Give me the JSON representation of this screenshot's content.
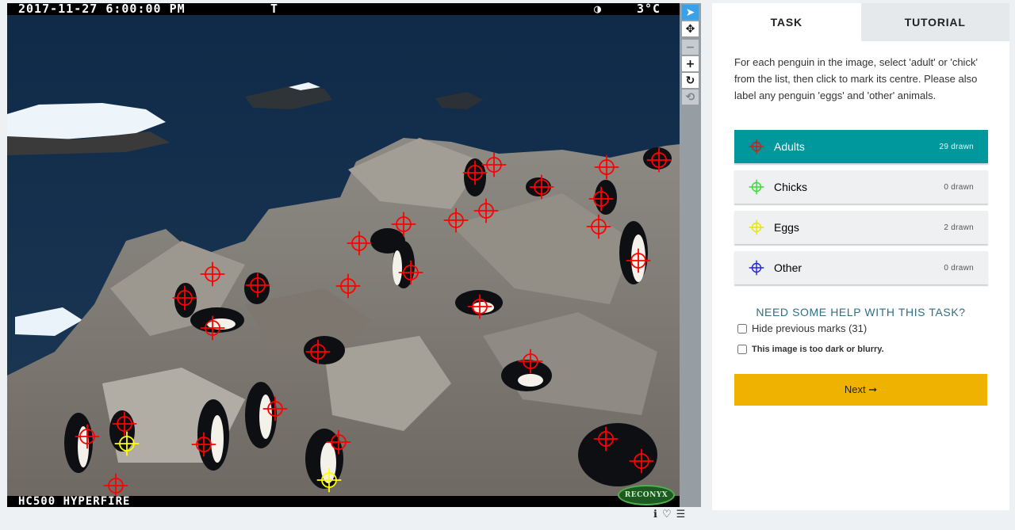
{
  "camera": {
    "date": "2017-11-27 6:00:00 PM",
    "flag": "T",
    "moon": "◑",
    "temperature": "3°C",
    "model": "HC500 HYPERFIRE",
    "brand": "RECONYX"
  },
  "toolbar": {
    "tools": [
      {
        "name": "pointer-icon",
        "glyph": "➤",
        "state": "active"
      },
      {
        "name": "move-icon",
        "glyph": "✥",
        "state": "normal"
      },
      {
        "name": "zoom-out-icon",
        "glyph": "−",
        "state": "disabled"
      },
      {
        "name": "zoom-in-icon",
        "glyph": "+",
        "state": "normal"
      },
      {
        "name": "rotate-icon",
        "glyph": "↻",
        "state": "normal"
      },
      {
        "name": "reset-icon",
        "glyph": "⟲",
        "state": "disabled"
      }
    ]
  },
  "footer_icons": [
    {
      "name": "info-icon",
      "glyph": "ℹ"
    },
    {
      "name": "favorite-icon",
      "glyph": "♡"
    },
    {
      "name": "collections-icon",
      "glyph": "☰"
    }
  ],
  "panel": {
    "tabs": [
      {
        "label": "TASK",
        "active": true
      },
      {
        "label": "TUTORIAL",
        "active": false
      }
    ],
    "instructions": "For each penguin in the image, select 'adult' or 'chick' from the list, then click to mark its centre. Please also label any penguin 'eggs' and 'other' animals.",
    "tools": [
      {
        "label": "Adults",
        "count": "29 drawn",
        "color": "#cc2020",
        "selected": true
      },
      {
        "label": "Chicks",
        "count": "0 drawn",
        "color": "#33dd33",
        "selected": false
      },
      {
        "label": "Eggs",
        "count": "2 drawn",
        "color": "#e6e600",
        "selected": false
      },
      {
        "label": "Other",
        "count": "0 drawn",
        "color": "#2222dd",
        "selected": false
      }
    ],
    "help": "NEED SOME HELP WITH THIS TASK?",
    "hide_marks": "Hide previous marks (31)",
    "too_dark": "This image is too dark or blurry.",
    "next": "Next ➞"
  },
  "marks": {
    "adult_color": "#ff0000",
    "egg_color": "#ffff00"
  }
}
